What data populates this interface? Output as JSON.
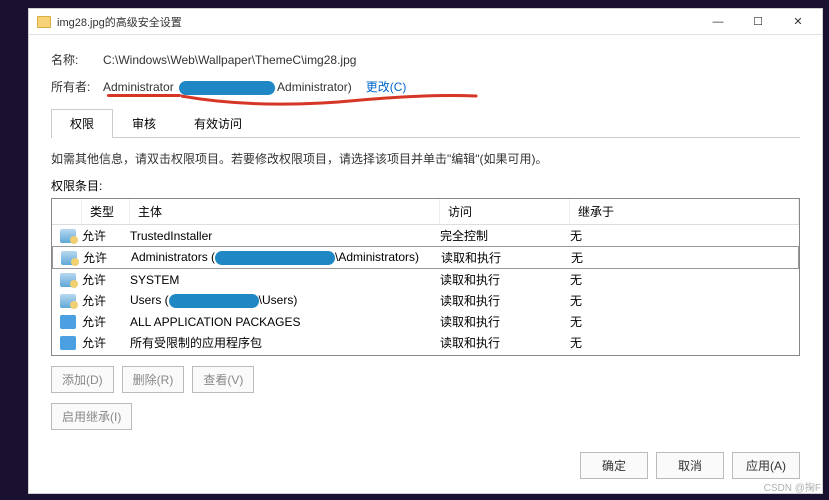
{
  "window": {
    "title": "img28.jpg的高级安全设置"
  },
  "tbtns": {
    "min": "—",
    "max": "☐",
    "close": "✕"
  },
  "info": {
    "name_label": "名称:",
    "name_value": "C:\\Windows\\Web\\Wallpaper\\ThemeC\\img28.jpg",
    "owner_label": "所有者:",
    "owner_value_pre": "Administrator",
    "owner_value_post": "Administrator)",
    "change_link": "更改(C)"
  },
  "tabs": [
    {
      "label": "权限",
      "active": true
    },
    {
      "label": "审核",
      "active": false
    },
    {
      "label": "有效访问",
      "active": false
    }
  ],
  "help": "如需其他信息，请双击权限项目。若要修改权限项目，请选择该项目并单击\"编辑\"(如果可用)。",
  "list": {
    "label": "权限条目:",
    "headers": {
      "type": "类型",
      "principal": "主体",
      "access": "访问",
      "inherit": "继承于"
    },
    "rows": [
      {
        "icon": "principal",
        "type": "允许",
        "principal": "TrustedInstaller",
        "access": "完全控制",
        "inherit": "无",
        "redacted": false
      },
      {
        "icon": "principal",
        "type": "允许",
        "principal_pre": "Administrators (",
        "principal_post": "\\Administrators)",
        "access": "读取和执行",
        "inherit": "无",
        "redacted": true,
        "selected": true
      },
      {
        "icon": "principal",
        "type": "允许",
        "principal": "SYSTEM",
        "access": "读取和执行",
        "inherit": "无",
        "redacted": false
      },
      {
        "icon": "principal",
        "type": "允许",
        "principal_pre": "Users (",
        "principal_post": "\\Users)",
        "access": "读取和执行",
        "inherit": "无",
        "redacted": true
      },
      {
        "icon": "package",
        "type": "允许",
        "principal": "ALL APPLICATION PACKAGES",
        "access": "读取和执行",
        "inherit": "无",
        "redacted": false
      },
      {
        "icon": "package",
        "type": "允许",
        "principal": "所有受限制的应用程序包",
        "access": "读取和执行",
        "inherit": "无",
        "redacted": false
      }
    ]
  },
  "buttons": {
    "add": "添加(D)",
    "remove": "删除(R)",
    "view": "查看(V)",
    "enable_inherit": "启用继承(I)",
    "ok": "确定",
    "cancel": "取消",
    "apply": "应用(A)"
  },
  "watermark": "CSDN @掬F"
}
